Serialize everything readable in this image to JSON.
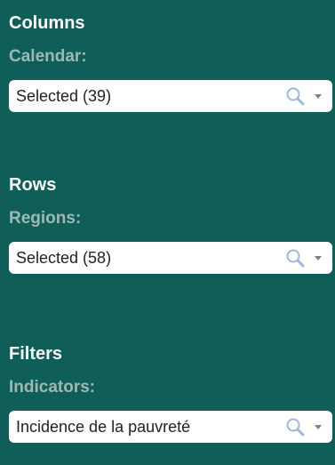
{
  "columns": {
    "title": "Columns",
    "label": "Calendar:",
    "value": "Selected (39)"
  },
  "rows": {
    "title": "Rows",
    "label": "Regions:",
    "value": "Selected (58)"
  },
  "filters": {
    "title": "Filters",
    "label": "Indicators:",
    "value": "Incidence de la pauvreté"
  },
  "icons": {
    "search": "search-icon",
    "dropdown": "chevron-down-icon"
  },
  "colors": {
    "background": "#0f5e58",
    "heading": "#ffffff",
    "label": "#9fb8b3"
  }
}
